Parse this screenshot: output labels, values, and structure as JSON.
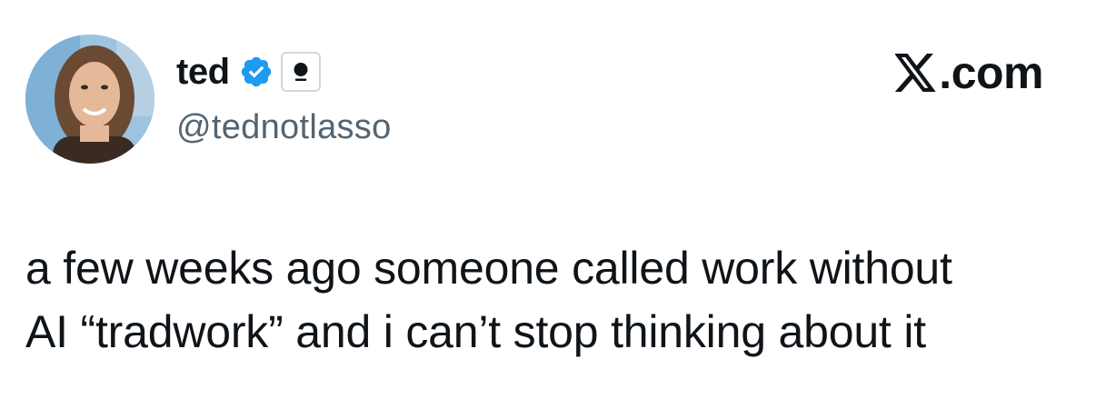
{
  "author": {
    "display_name": "ted",
    "handle": "@tednotlasso",
    "verified": true,
    "avatar_icon": "profile-photo",
    "affiliate_icon": "microphone-icon"
  },
  "brand": {
    "text": ".com",
    "logo_icon": "x-logo-icon"
  },
  "tweet": {
    "lines": [
      "a few weeks ago someone called work without",
      "AI “tradwork” and i can’t stop thinking about it"
    ]
  },
  "colors": {
    "verified_blue": "#1d9bf0",
    "text_primary": "#0f1419",
    "text_secondary": "#536471"
  }
}
